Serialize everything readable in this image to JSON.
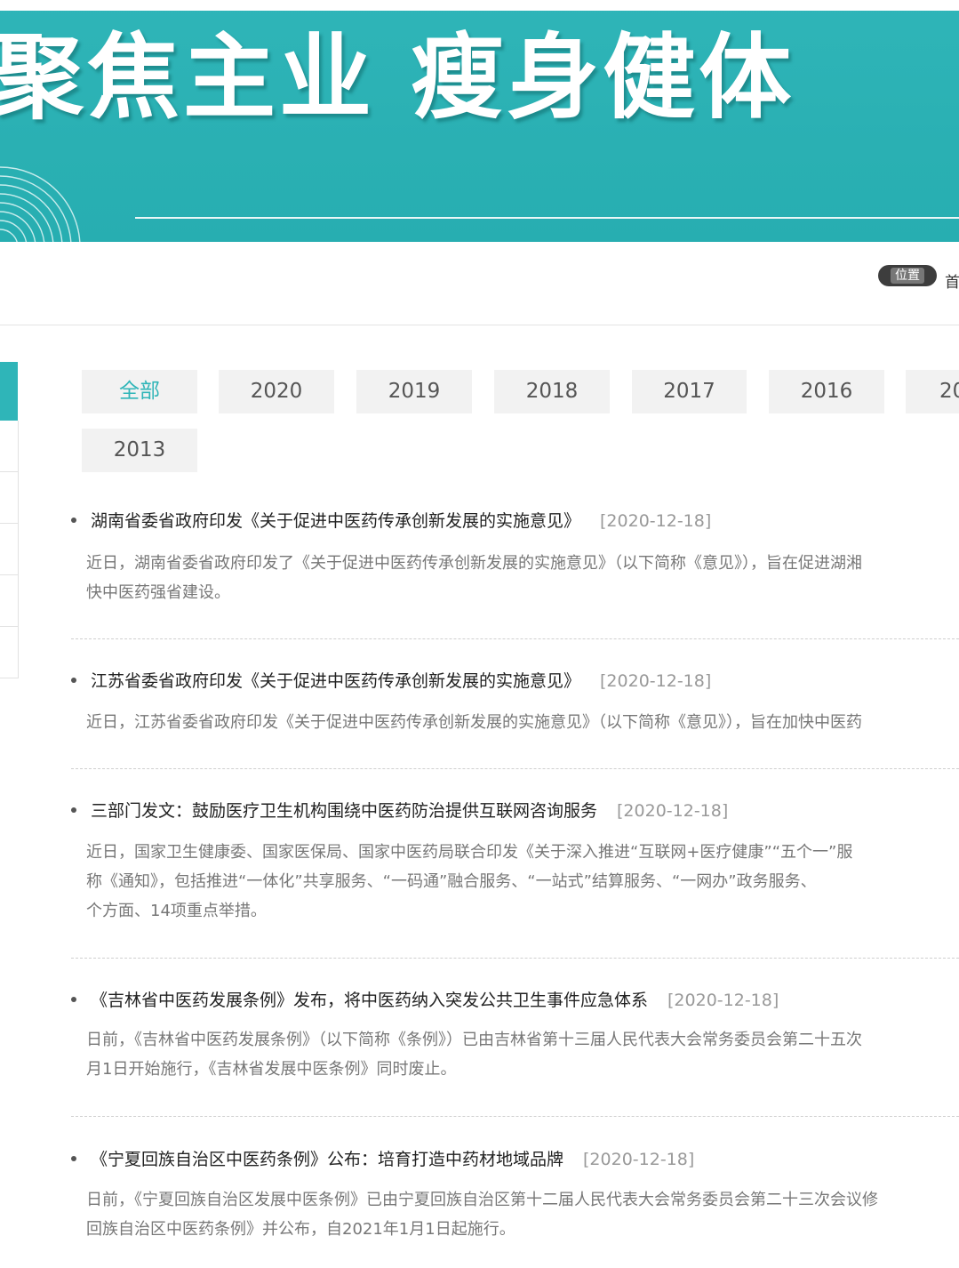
{
  "banner": {
    "slogan": "聚焦主业 瘦身健体",
    "accent": "#2fb5b8"
  },
  "location": {
    "badge_label": "位置",
    "home_link": "首"
  },
  "tabs": [
    {
      "label": "全部",
      "active": true
    },
    {
      "label": "2020"
    },
    {
      "label": "2019"
    },
    {
      "label": "2018"
    },
    {
      "label": "2017"
    },
    {
      "label": "2016"
    },
    {
      "label": "20"
    },
    {
      "label": "2013"
    }
  ],
  "news": [
    {
      "title": "湖南省委省政府印发《关于促进中医药传承创新发展的实施意见》",
      "date": "[2020-12-18]",
      "desc": [
        "近日，湖南省委省政府印发了《关于促进中医药传承创新发展的实施意见》（以下简称《意见》），旨在促进湖湘",
        "快中医药强省建设。"
      ]
    },
    {
      "title": "江苏省委省政府印发《关于促进中医药传承创新发展的实施意见》",
      "date": "[2020-12-18]",
      "desc": [
        "近日，江苏省委省政府印发《关于促进中医药传承创新发展的实施意见》（以下简称《意见》），旨在加快中医药"
      ]
    },
    {
      "title": "三部门发文：鼓励医疗卫生机构围绕中医药防治提供互联网咨询服务",
      "date": "[2020-12-18]",
      "desc": [
        "近日，国家卫生健康委、国家医保局、国家中医药局联合印发《关于深入推进“互联网+医疗健康”“五个一”服",
        "称《通知》，包括推进“一体化”共享服务、“一码通”融合服务、“一站式”结算服务、“一网办”政务服务、",
        "个方面、14项重点举措。"
      ]
    },
    {
      "title": "《吉林省中医药发展条例》发布，将中医药纳入突发公共卫生事件应急体系",
      "date": "[2020-12-18]",
      "desc": [
        "日前，《吉林省中医药发展条例》（以下简称《条例》）已由吉林省第十三届人民代表大会常务委员会第二十五次",
        "月1日开始施行，《吉林省发展中医条例》同时废止。"
      ]
    },
    {
      "title": "《宁夏回族自治区中医药条例》公布：培育打造中药材地域品牌",
      "date": "[2020-12-18]",
      "desc": [
        "日前，《宁夏回族自治区发展中医条例》已由宁夏回族自治区第十二届人民代表大会常务委员会第二十三次会议修",
        "回族自治区中医药条例》并公布，自2021年1月1日起施行。"
      ]
    }
  ]
}
